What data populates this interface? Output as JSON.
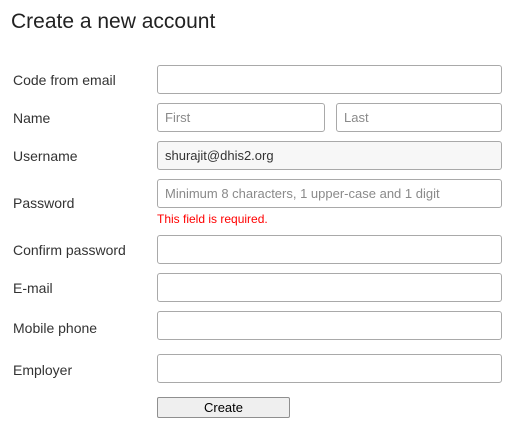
{
  "title": "Create a new account",
  "fields": {
    "code": {
      "label": "Code from email",
      "value": ""
    },
    "name": {
      "label": "Name",
      "first_placeholder": "First",
      "last_placeholder": "Last"
    },
    "username": {
      "label": "Username",
      "value": "shurajit@dhis2.org"
    },
    "password": {
      "label": "Password",
      "placeholder": "Minimum 8 characters, 1 upper-case and 1 digit",
      "error": "This field is required."
    },
    "confirm": {
      "label": "Confirm password"
    },
    "email": {
      "label": "E-mail"
    },
    "mobile": {
      "label": "Mobile phone"
    },
    "employer": {
      "label": "Employer"
    }
  },
  "create_label": "Create",
  "colors": {
    "error": "#ff0000"
  }
}
